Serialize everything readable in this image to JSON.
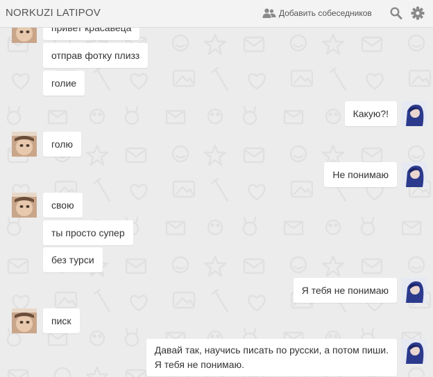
{
  "header": {
    "title": "NORKUZI LATIPOV",
    "add_label": "Добавить собеседников"
  },
  "messages": [
    {
      "text": "привет красавеца",
      "side": "in"
    },
    {
      "text": "отправ фотку плизз",
      "side": "in"
    },
    {
      "text": "голие",
      "side": "in"
    },
    {
      "text": "Какую?!",
      "side": "out"
    },
    {
      "text": "голю",
      "side": "in"
    },
    {
      "text": "Не понимаю",
      "side": "out"
    },
    {
      "text": "свою",
      "side": "in"
    },
    {
      "text": "ты просто супер",
      "side": "in"
    },
    {
      "text": "без турси",
      "side": "in"
    },
    {
      "text": "Я тебя не понимаю",
      "side": "out"
    },
    {
      "text": "писк",
      "side": "in"
    },
    {
      "text": "Давай так, научись писать по русски, а потом пиши.\nЯ тебя не понимаю.",
      "side": "out"
    }
  ],
  "colors": {
    "background": "#ececec",
    "bubble": "#ffffff",
    "header": "#f3f3f3",
    "icon": "#8a8a8a"
  }
}
